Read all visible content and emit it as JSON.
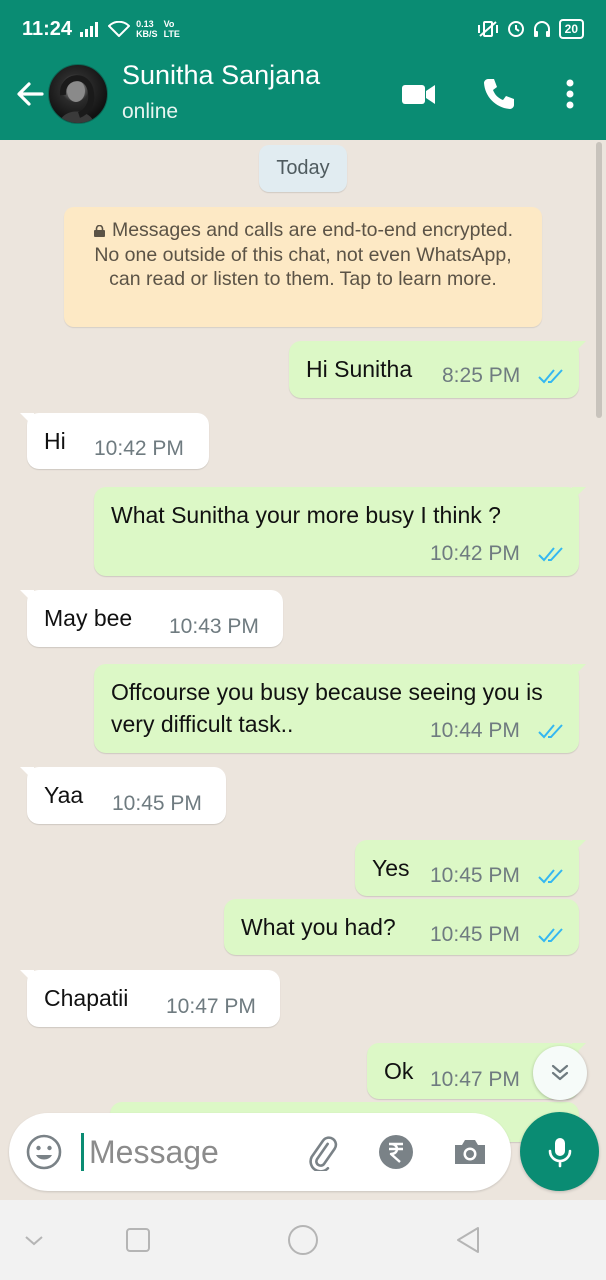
{
  "status_bar": {
    "time": "11:24",
    "net_speed": "0.13",
    "net_unit": "KB/S",
    "volte": "Vo",
    "lte": "LTE",
    "battery": "20"
  },
  "header": {
    "contact_name": "Sunitha Sanjana",
    "contact_status": "online",
    "icons": [
      "back-arrow-icon",
      "video-call-icon",
      "voice-call-icon",
      "more-vert-icon"
    ]
  },
  "chat": {
    "date_label": "Today",
    "encryption_notice": "Messages and calls are end-to-end encrypted. No one outside of this chat, not even WhatsApp, can read or listen to them. Tap to learn more.",
    "messages": [
      {
        "dir": "out",
        "text": "Hi Sunitha",
        "time": "8:25 PM",
        "read": true
      },
      {
        "dir": "in",
        "text": "Hi",
        "time": "10:42 PM"
      },
      {
        "dir": "out",
        "text": "What Sunitha your more busy I think ?",
        "time": "10:42 PM",
        "read": true
      },
      {
        "dir": "in",
        "text": "May bee",
        "time": "10:43 PM"
      },
      {
        "dir": "out",
        "text": "Offcourse you busy because seeing you is very difficult task..",
        "time": "10:44 PM",
        "read": true
      },
      {
        "dir": "in",
        "text": "Yaa",
        "time": "10:45 PM"
      },
      {
        "dir": "out",
        "text": "Yes",
        "time": "10:45 PM",
        "read": true
      },
      {
        "dir": "out",
        "text": "What you had?",
        "time": "10:45 PM",
        "read": true
      },
      {
        "dir": "in",
        "text": "Chapatii",
        "time": "10:47 PM"
      },
      {
        "dir": "out",
        "text": "Ok",
        "time": "10:47 PM",
        "read": true
      }
    ]
  },
  "composer": {
    "placeholder": "Message",
    "icons": [
      "emoji-icon",
      "attach-icon",
      "rupee-payment-icon",
      "camera-icon",
      "mic-icon"
    ]
  },
  "colors": {
    "brand": "#0a8c73",
    "chat_bg": "#ece5dd",
    "outgoing_bubble": "#dcf8c6",
    "incoming_bubble": "#ffffff",
    "read_tick": "#34b7f1",
    "encryption_bg": "#fde9c5"
  }
}
